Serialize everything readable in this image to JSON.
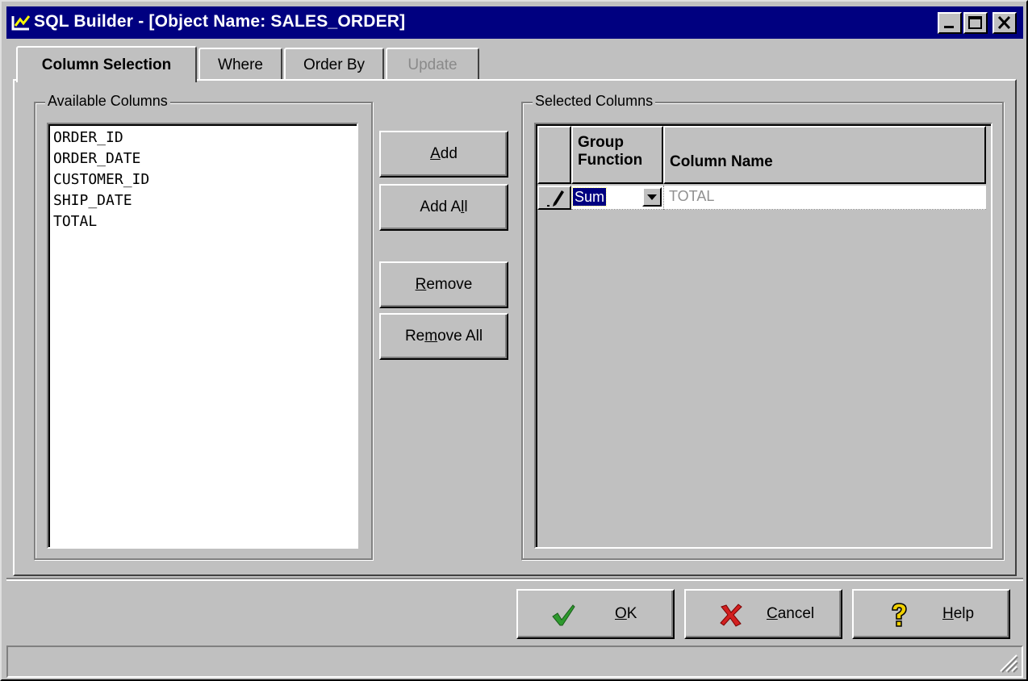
{
  "window": {
    "title": "SQL Builder - [Object Name:  SALES_ORDER]"
  },
  "tabs": [
    {
      "label": "Column Selection",
      "state": "active"
    },
    {
      "label": "Where",
      "state": "normal"
    },
    {
      "label": "Order By",
      "state": "normal"
    },
    {
      "label": "Update",
      "state": "disabled"
    }
  ],
  "available": {
    "label": "Available Columns",
    "items": [
      "ORDER_ID",
      "ORDER_DATE",
      "CUSTOMER_ID",
      "SHIP_DATE",
      "TOTAL"
    ]
  },
  "actions": {
    "add": {
      "pre": "",
      "key": "A",
      "post": "dd"
    },
    "add_all": {
      "pre": "Add A",
      "key": "l",
      "post": "l"
    },
    "remove": {
      "pre": "",
      "key": "R",
      "post": "emove"
    },
    "remove_all": {
      "pre": "Re",
      "key": "m",
      "post": "ove All"
    }
  },
  "selected": {
    "label": "Selected Columns",
    "headers": {
      "group_line1": "Group",
      "group_line2": "Function",
      "column_name": "Column Name"
    },
    "rows": [
      {
        "group_function": "Sum",
        "column_name": "TOTAL"
      }
    ]
  },
  "footer": {
    "ok": {
      "key": "O",
      "rest": "K"
    },
    "cancel": {
      "key": "C",
      "rest": "ancel"
    },
    "help": {
      "key": "H",
      "rest": "elp"
    }
  },
  "colors": {
    "titlebar": "#000080",
    "face": "#c0c0c0",
    "ok_check": "#2e9a2e",
    "cancel_x": "#d22020",
    "help_q": "#f0d000"
  },
  "icons": {
    "app": "sql-builder-icon",
    "minimize": "minimize-icon",
    "maximize": "maximize-icon",
    "close": "close-icon",
    "row_edit": "pencil-icon",
    "dropdown": "chevron-down-icon",
    "ok": "checkmark-icon",
    "cancel": "x-icon",
    "help": "question-mark-icon"
  }
}
